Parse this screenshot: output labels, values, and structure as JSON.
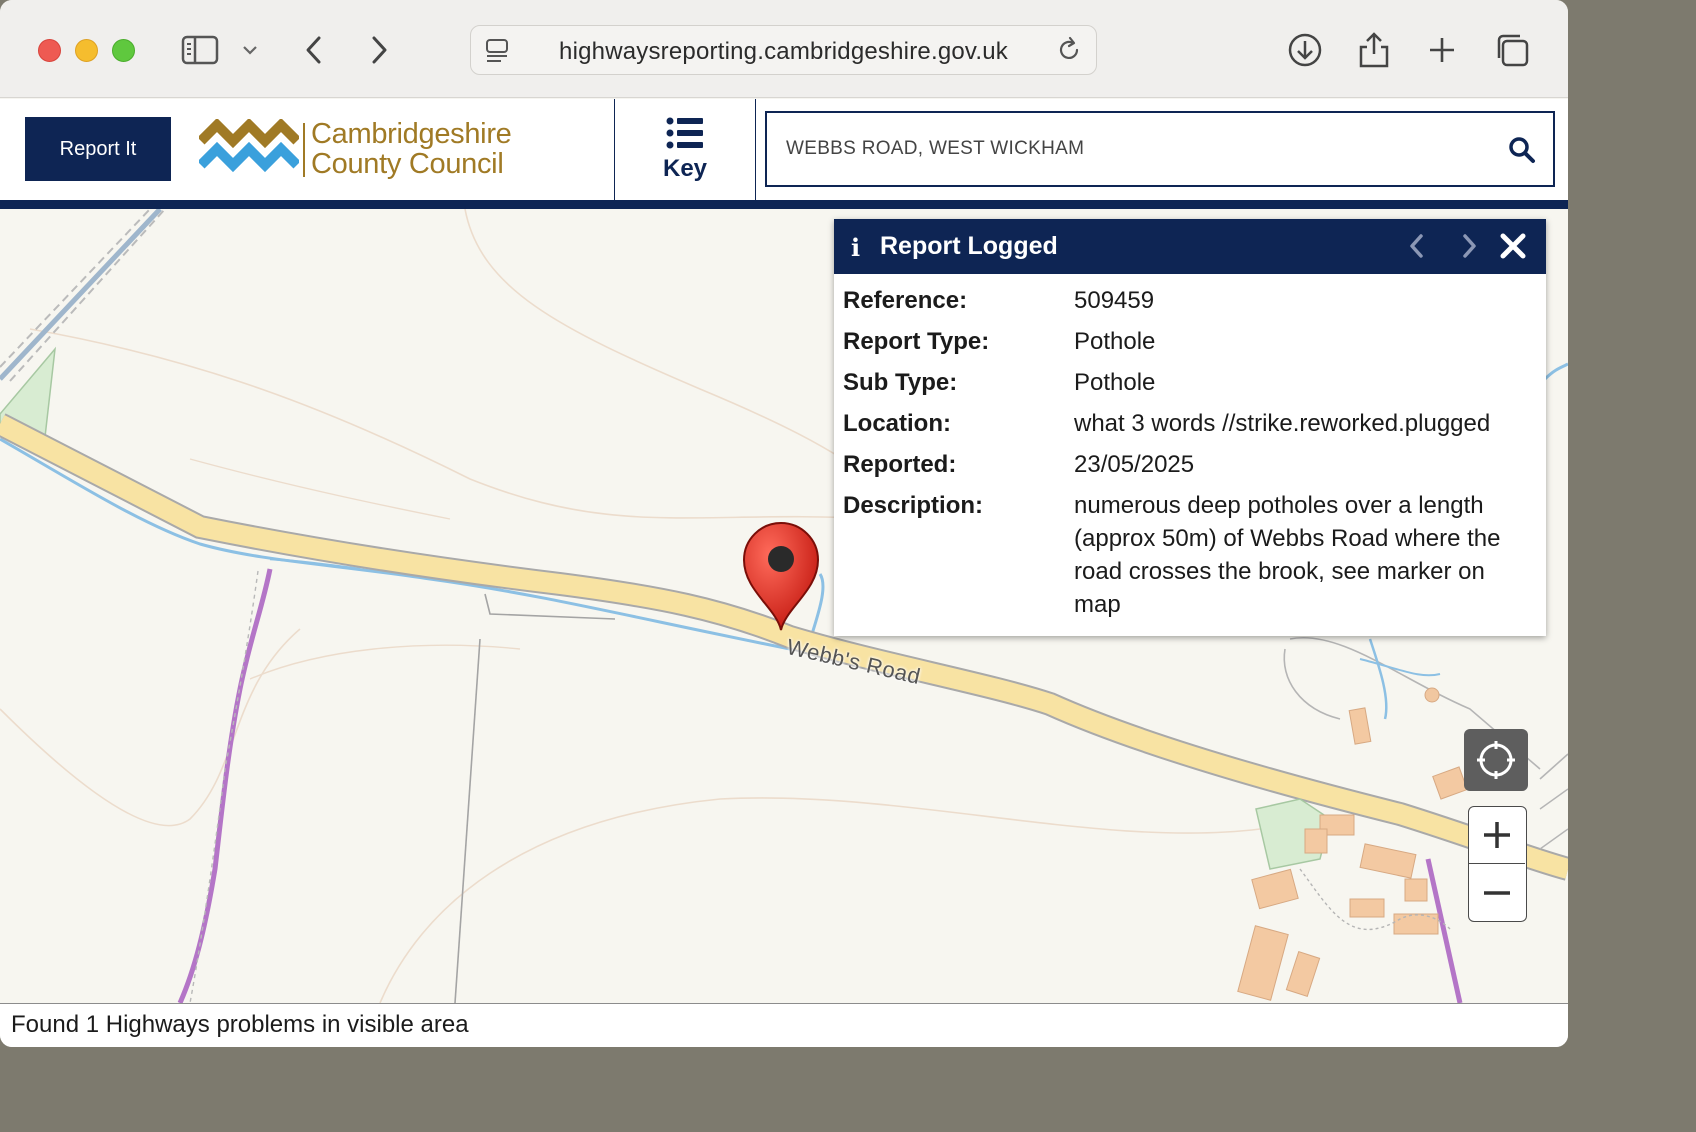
{
  "browser": {
    "url": "highwaysreporting.cambridgeshire.gov.uk"
  },
  "header": {
    "report_button": "Report It",
    "logo_line1": "Cambridgeshire",
    "logo_line2": "County Council",
    "key_label": "Key",
    "search_value": "WEBBS ROAD, WEST WICKHAM"
  },
  "map": {
    "road_label": "Webb's Road",
    "marker_icon": "map-pin-icon"
  },
  "popup": {
    "title": "Report Logged",
    "info_icon": "i",
    "fields": [
      {
        "label": "Reference:",
        "value": "509459"
      },
      {
        "label": "Report Type:",
        "value": "Pothole"
      },
      {
        "label": "Sub Type:",
        "value": "Pothole"
      },
      {
        "label": "Location:",
        "value": "what 3 words //strike.reworked.plugged"
      },
      {
        "label": "Reported:",
        "value": "23/05/2025"
      },
      {
        "label": "Description:",
        "value": "numerous deep potholes over a length (approx 50m) of Webbs Road where the road crosses the brook, see marker on map"
      }
    ]
  },
  "status": {
    "text": "Found 1 Highways problems in visible area"
  },
  "colors": {
    "brand_navy": "#0e2554",
    "logo_gold": "#a07a25",
    "logo_blue": "#3aa0dc",
    "road_fill": "#f8e3a3",
    "marker_red": "#d42a20"
  }
}
